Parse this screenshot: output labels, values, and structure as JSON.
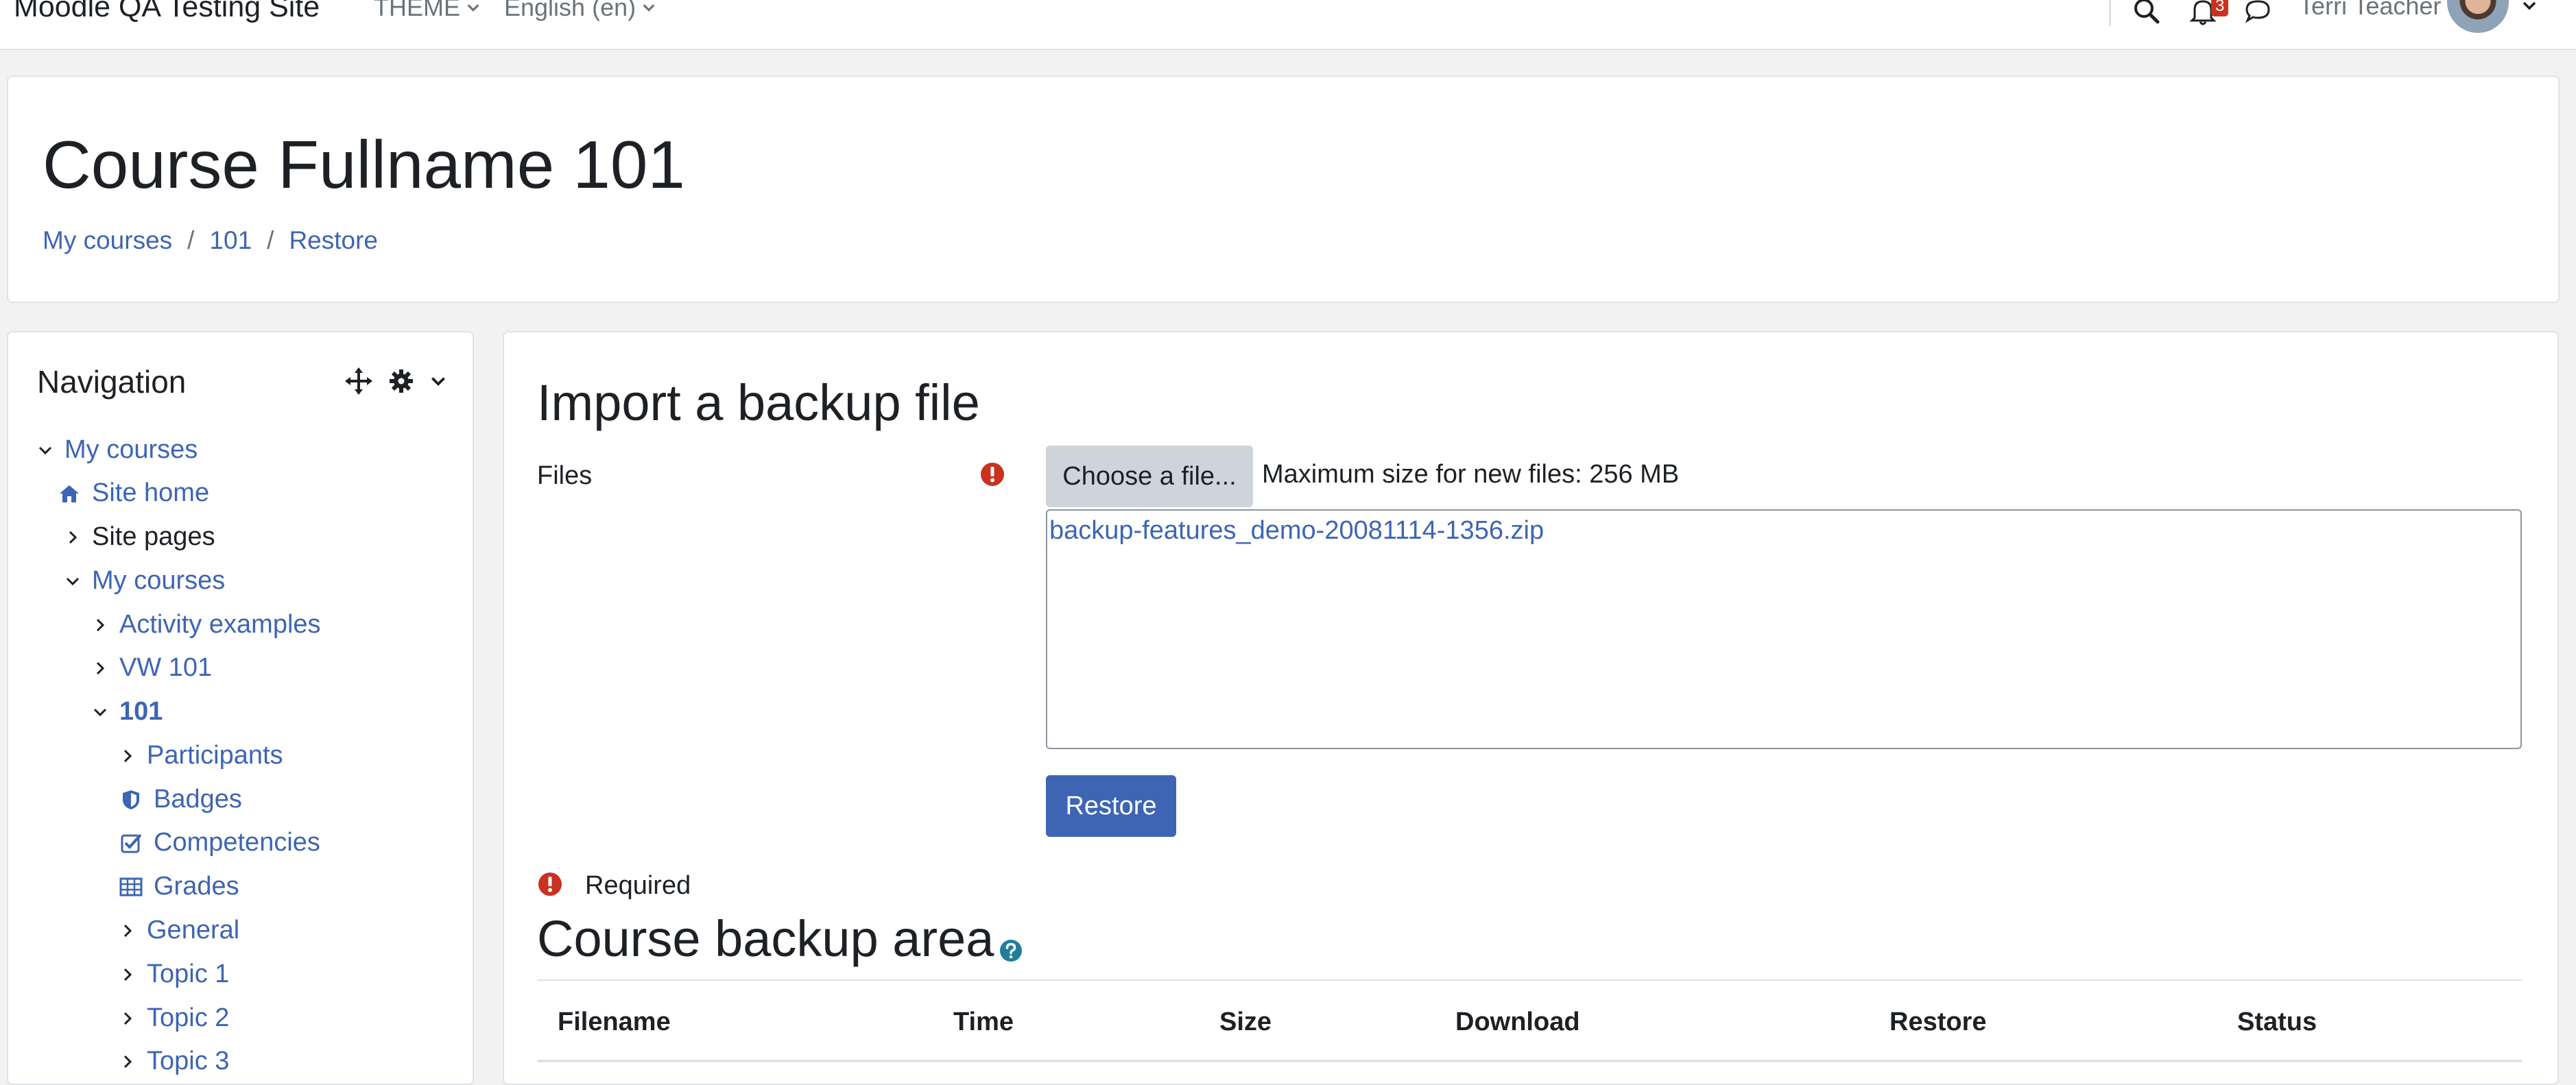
{
  "navbar": {
    "site_name": "Moodle QA Testing Site",
    "theme_menu": "THEME",
    "language_menu": "English (en)",
    "notifications_count": "3",
    "user_name": "Terri Teacher"
  },
  "header": {
    "course_title": "Course Fullname 101",
    "breadcrumb": [
      "My courses",
      "101",
      "Restore"
    ],
    "breadcrumb_separator": "/"
  },
  "navigation": {
    "title": "Navigation",
    "items": [
      {
        "label": "My courses",
        "icon": "chevron-down-icon"
      },
      {
        "label": "Site home",
        "icon": "home-icon"
      },
      {
        "label": "Site pages",
        "icon": "chevron-right-icon"
      },
      {
        "label": "My courses",
        "icon": "chevron-down-icon"
      },
      {
        "label": "Activity examples",
        "icon": "chevron-right-icon"
      },
      {
        "label": "VW 101",
        "icon": "chevron-right-icon"
      },
      {
        "label": "101",
        "icon": "chevron-down-icon"
      },
      {
        "label": "Participants",
        "icon": "chevron-right-icon"
      },
      {
        "label": "Badges",
        "icon": "shield-icon"
      },
      {
        "label": "Competencies",
        "icon": "checkbox-icon"
      },
      {
        "label": "Grades",
        "icon": "table-icon"
      },
      {
        "label": "General",
        "icon": "chevron-right-icon"
      },
      {
        "label": "Topic 1",
        "icon": "chevron-right-icon"
      },
      {
        "label": "Topic 2",
        "icon": "chevron-right-icon"
      },
      {
        "label": "Topic 3",
        "icon": "chevron-right-icon"
      }
    ]
  },
  "main": {
    "import_heading": "Import a backup file",
    "files_label": "Files",
    "choose_file_label": "Choose a file...",
    "max_size_text": "Maximum size for new files: 256 MB",
    "file_name": "backup-features_demo-20081114-1356.zip",
    "restore_button": "Restore",
    "required_text": "Required",
    "backup_area_heading": "Course backup area",
    "table_headers": [
      "Filename",
      "Time",
      "Size",
      "Download",
      "Restore",
      "Status"
    ]
  },
  "colors": {
    "link": "#3d65b3",
    "primary_button": "#3d65b3",
    "secondary_button": "#ced4da",
    "required_icon": "#ca3120",
    "help_icon": "#1f7e9a"
  }
}
